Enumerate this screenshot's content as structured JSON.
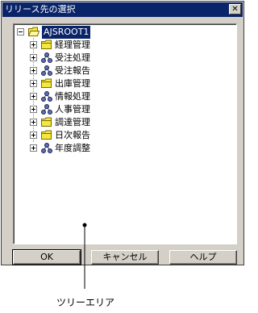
{
  "window": {
    "title": "リリース先の選択",
    "close_glyph": "✕"
  },
  "tree": {
    "root": {
      "label": "AJSROOT1",
      "icon": "folder-open-icon"
    },
    "items": [
      {
        "label": "経理管理",
        "icon": "folder-icon"
      },
      {
        "label": "受注処理",
        "icon": "jobnet-icon"
      },
      {
        "label": "受注報告",
        "icon": "jobnet-icon"
      },
      {
        "label": "出庫管理",
        "icon": "folder-icon"
      },
      {
        "label": "情報処理",
        "icon": "jobnet-icon"
      },
      {
        "label": "人事管理",
        "icon": "jobnet-icon"
      },
      {
        "label": "調達管理",
        "icon": "folder-icon"
      },
      {
        "label": "日次報告",
        "icon": "folder-icon"
      },
      {
        "label": "年度調整",
        "icon": "jobnet-icon"
      }
    ]
  },
  "buttons": {
    "ok": "OK",
    "cancel": "キャンセル",
    "help": "ヘルプ"
  },
  "annotation": {
    "label": "ツリーエリア"
  },
  "colors": {
    "selection": "#0a246a",
    "folder": "#f5e642",
    "jobnet": "#5a6fb8"
  }
}
